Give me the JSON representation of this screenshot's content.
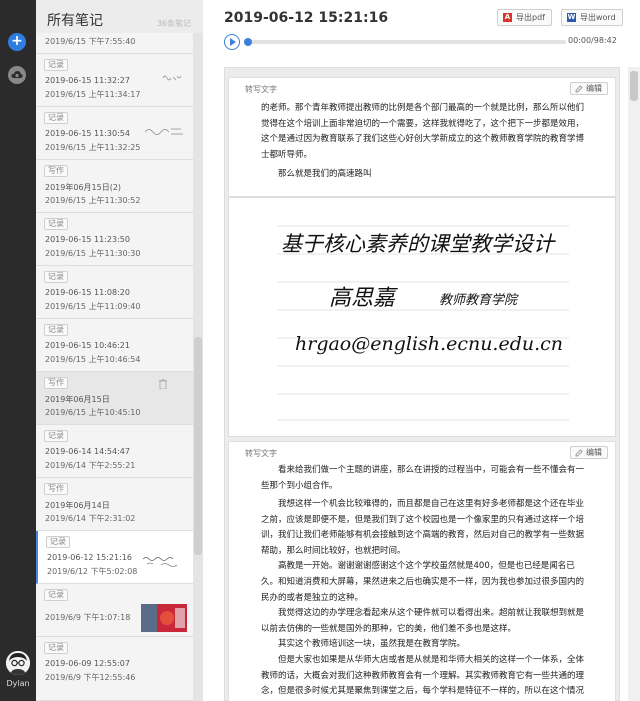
{
  "user": {
    "name": "Dylan"
  },
  "list": {
    "title": "所有笔记",
    "count": "36条笔记",
    "partial_top_time": "2019/6/15 下午7:55:40",
    "notes": [
      {
        "tag": "记录",
        "line1": "2019-06-15 11:32:27",
        "line2": "2019/6/15 上午11:34:17"
      },
      {
        "tag": "记录",
        "line1": "2019-06-15 11:30:54",
        "line2": "2019/6/15 上午11:32:25"
      },
      {
        "tag": "写作",
        "line1": "2019年06月15日(2)",
        "line2": "2019/6/15 上午11:30:52"
      },
      {
        "tag": "记录",
        "line1": "2019-06-15 11:23:50",
        "line2": "2019/6/15 上午11:30:30"
      },
      {
        "tag": "记录",
        "line1": "2019-06-15 11:08:20",
        "line2": "2019/6/15 上午11:09:40"
      },
      {
        "tag": "记录",
        "line1": "2019-06-15 10:46:21",
        "line2": "2019/6/15 上午10:46:54"
      },
      {
        "tag": "写作",
        "line1": "2019年06月15日",
        "line2": "2019/6/15 上午10:45:10"
      },
      {
        "tag": "记录",
        "line1": "2019-06-14 14:54:47",
        "line2": "2019/6/14 下午2:55:21"
      },
      {
        "tag": "写作",
        "line1": "2019年06月14日",
        "line2": "2019/6/14 下午2:31:02"
      },
      {
        "tag": "记录",
        "line1": "2019-06-12 15:21:16",
        "line2": "2019/6/12 下午5:02:08"
      },
      {
        "tag": "记录",
        "line1": "",
        "line2": "2019/6/9 下午1:07:18"
      },
      {
        "tag": "记录",
        "line1": "2019-06-09 12:55:07",
        "line2": "2019/6/9 下午12:55:46"
      }
    ]
  },
  "main": {
    "datetime": "2019-06-12 15:21:16",
    "export_pdf": "导出pdf",
    "export_word": "导出word",
    "player": {
      "time": "00:00/98:42",
      "progress": 0
    },
    "card1": {
      "label": "转写文字",
      "edit": "编辑",
      "paragraphs": [
        "的老师。那个青年教师提出教师的比例是各个部门最高的一个就是比例，那么所以他们觉得在这个培训上面非常迫切的一个需要，这样我就得吃了，这个把下一步都是效用，这个是通过因为教育联系了我们这些心好创大学新成立的这个教师教育学院的教育学博士都听导师。",
        "那么就是我们的高速路叫"
      ]
    },
    "handwriting": {
      "line1": "基于核心素养的课堂教学设计",
      "line2": "高思嘉",
      "line3": "教师教育学院",
      "line4": "hrgao@english.ecnu.edu.cn"
    },
    "card2": {
      "label": "转写文字",
      "edit": "编辑",
      "paragraphs": [
        "看来给我们做一个主题的讲座，那么在讲授的过程当中，可能会有一些不懂会有一些那个到小组合作。",
        "我想这样一个机会比较难得的，而且都是自己在这里有好多老师都是这个还在毕业之前，应该是即便不是，但是我们到了这个校园也是一个像家里的只有通过这样一个培训，我们让我们老师能够有机会接触到这个高端的教育，然后对自己的教学有一些数据帮助，那么时间比较好，也就把时间。",
        "高教是一开始。谢谢谢谢感谢这个这个学校虽然就是400，但是也已经是闻名已久。",
        "和知道消费和大屏幕，果然进来之后也确实是不一样，因为我也参加过很多国内的民办的或者是独立的这种。",
        "我觉得这边的办学理念看起来从这个硬件就可以看得出来。超前就让我联想到就是以前去仿佛的一些就是国外的那种，它的美，他们差不多也是这样。",
        "其实这个教师培训这一块，虽然我是在教育学院。",
        "但是大家也如果是从华师大店或者是从就是和华师大相关的这样一个一体系，全体教师的话，大概会对我们这种教师教育会有一个理解。其实教师教育它有一些共通的理念，但是很多时候尤其是聚焦到课堂之后，每个学科是特征不一样的，所以在这个情况之下，其"
      ]
    }
  }
}
